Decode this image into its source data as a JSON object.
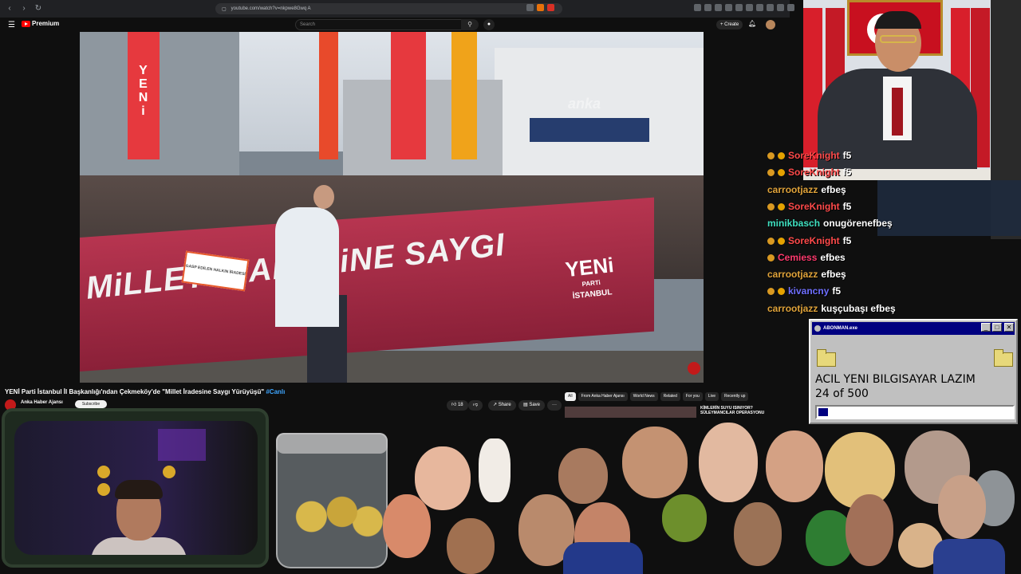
{
  "browser": {
    "url": "youtube.com/watch?v=nkpwe8Gwq A"
  },
  "yt": {
    "logo": "Premium",
    "search_placeholder": "Search",
    "create_label": "+ Create"
  },
  "video": {
    "watermark": "anka",
    "banner_text": "MiLLET iRADESiNE SAYGI",
    "banner_party": "YENi",
    "banner_party_sub": "PARTi",
    "banner_city": "İSTANBUL",
    "flag_text": "YENi",
    "sign_text": "GASP EDİLEN HALKIN İRADESİ"
  },
  "info": {
    "title": "YENİ Parti İstanbul İl Başkanlığı'ndan Çekmeköy'de \"Millet İradesine Saygı Yürüyüşü\"",
    "live_tag": "#Canlı",
    "channel": "Anka Haber Ajansı",
    "subscribe": "Subscribe",
    "likes": "18",
    "share": "Share",
    "save": "Save",
    "more": "···"
  },
  "chips": [
    "All",
    "From Anka Haber Ajansı",
    "World News",
    "Related",
    "For you",
    "Live",
    "Recently up"
  ],
  "recommendation": {
    "title": "KİMLERİN SUYU ISINIYOR? SÜLEYMANCILAR OPERASYONU"
  },
  "chat": [
    {
      "user": "SoreKnight",
      "msg": "f5",
      "color": "#ff4a4a",
      "badges": 2
    },
    {
      "user": "SoreKnight",
      "msg": "f5",
      "color": "#ff4a4a",
      "badges": 2
    },
    {
      "user": "carrootjazz",
      "msg": "efbeş",
      "color": "#e0a33a",
      "badges": 0
    },
    {
      "user": "SoreKnight",
      "msg": "f5",
      "color": "#ff4a4a",
      "badges": 2
    },
    {
      "user": "minikbasch",
      "msg": "onugörenefbeş",
      "color": "#3fe0c0",
      "badges": 0
    },
    {
      "user": "SoreKnight",
      "msg": "f5",
      "color": "#ff4a4a",
      "badges": 2
    },
    {
      "user": "Cemiess",
      "msg": "efbes",
      "color": "#ff3a6e",
      "badges": 1
    },
    {
      "user": "carrootjazz",
      "msg": "efbeş",
      "color": "#e0a33a",
      "badges": 0
    },
    {
      "user": "kivancny",
      "msg": "f5",
      "color": "#6f6fff",
      "badges": 2
    },
    {
      "user": "carrootjazz",
      "msg": "kuşçubaşı efbeş",
      "color": "#e0a33a",
      "badges": 0
    }
  ],
  "popup": {
    "title": "ABONMAN.exe",
    "heading": "ACIL YENI BILGISAYAR LAZIM",
    "count_text": "24 of 500",
    "progress_fraction": 0.048
  }
}
